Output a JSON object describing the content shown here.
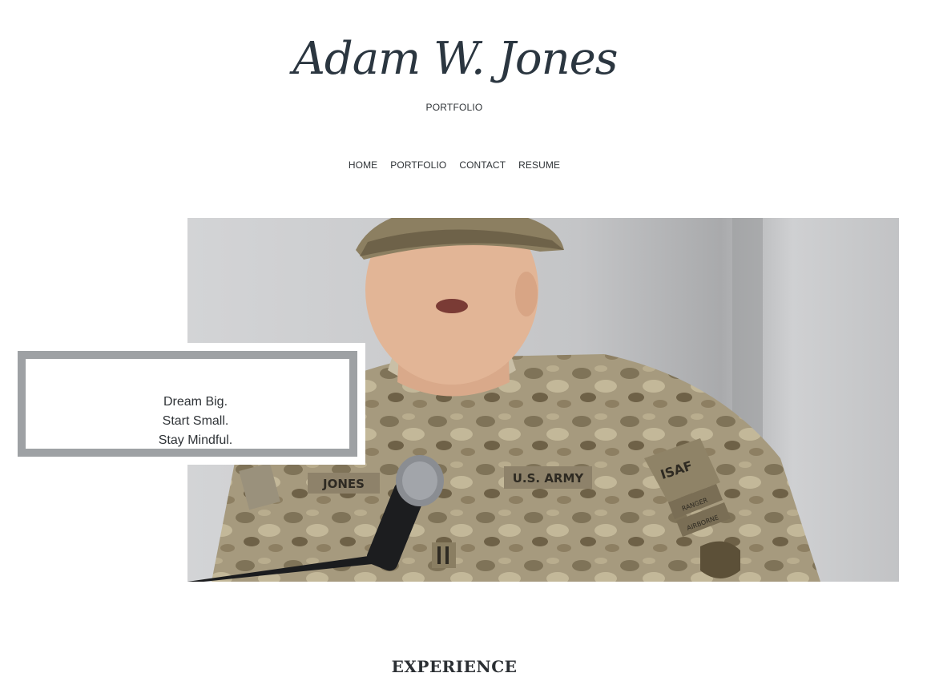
{
  "site": {
    "logo_text": "Adam W. Jones",
    "tagline": "PORTFOLIO"
  },
  "nav": {
    "items": [
      {
        "label": "HOME"
      },
      {
        "label": "PORTFOLIO"
      },
      {
        "label": "CONTACT"
      },
      {
        "label": "RESUME"
      }
    ]
  },
  "hero": {
    "image_icon": "photo-soldier-speaking-at-microphone",
    "quote_lines": [
      "Dream Big.",
      "Start Small.",
      "Stay Mindful."
    ],
    "patch_labels": {
      "name_tape": "JONES",
      "branch_tape": "U.S. ARMY",
      "isaf_patch": "ISAF",
      "ranger_tab": "RANGER",
      "airborne_tab": "AIRBORNE"
    }
  },
  "sections": {
    "experience_title": "EXPERIENCE"
  },
  "colors": {
    "text": "#2b2f33",
    "frame": "#9ea1a4",
    "background": "#ffffff"
  }
}
